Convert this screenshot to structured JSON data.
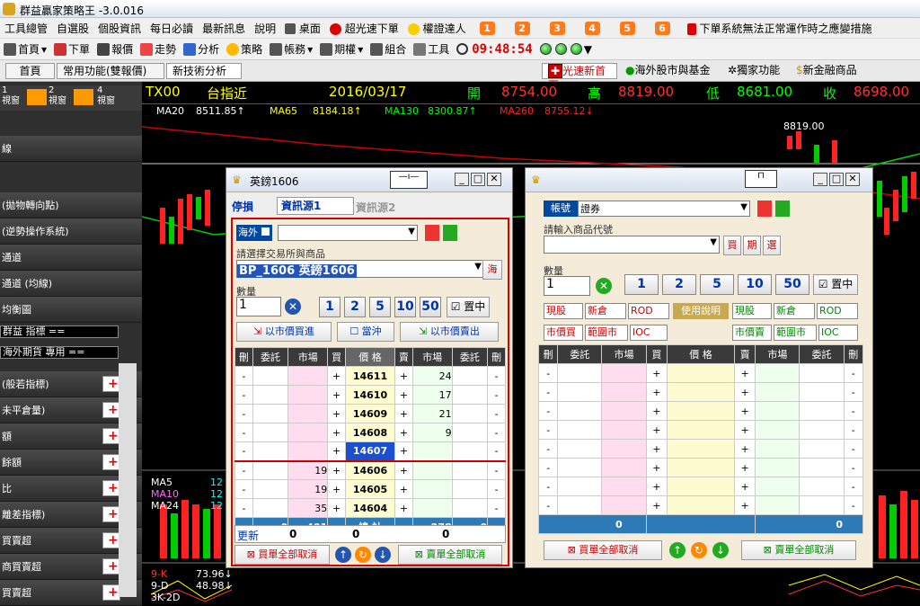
{
  "app": {
    "title": "群益贏家策略王 -3.0.016"
  },
  "menu": [
    "工具總管",
    "自選股",
    "個股資訊",
    "每日必讀",
    "最新訊息",
    "說明",
    "桌面",
    "超光速下單",
    "權證達人",
    "1",
    "2",
    "3",
    "4",
    "5",
    "6",
    "下單系統無法正常運作時之應變措施"
  ],
  "toolbar1": {
    "home": "首頁",
    "order": "下單",
    "quote": "報價",
    "trend": "走勢",
    "analysis": "分析",
    "strategy": "策略",
    "account": "帳務",
    "expiry": "期權",
    "combo": "組合",
    "tools": "工具",
    "clock": "09:48:54"
  },
  "toolbar2": {
    "tabs": [
      "首頁",
      "常用功能(雙報價)",
      "新技術分析"
    ],
    "fast_home": "光速新首頁",
    "overseas": "海外股市與基金",
    "exclusive": "獨家功能",
    "new_finance": "新金融商品"
  },
  "sidebar": {
    "view1": "1\n視窗",
    "view2": "2\n視窗",
    "view4": "4\n視窗",
    "rows": [
      "線",
      "(拋物轉向點)",
      "(逆勢操作系統)",
      "通道",
      "通道 (均線)",
      "均衡圖"
    ],
    "sel1": "群益 指標 ==",
    "sel2": "海外期貨 專用 ==",
    "rows2": [
      "(般若指標)",
      "未平倉量)",
      "額",
      "餘額",
      "比",
      "離差指標)",
      "買賣超",
      "商買賣超",
      "買賣超"
    ]
  },
  "chart": {
    "symbol": "TX00",
    "name": "台指近",
    "date": "2016/03/17",
    "open_label": "開",
    "open": "8754.00",
    "high_label": "高",
    "high": "8819.00",
    "low_label": "低",
    "low": "8681.00",
    "close_label": "收",
    "close": "8698.00",
    "ma": [
      {
        "label": "MA20",
        "value": "8511.85↑",
        "color": "#fff"
      },
      {
        "label": "MA65",
        "value": "8184.18↑",
        "color": "#ffff00"
      },
      {
        "label": "MA130",
        "value": "8300.87↑",
        "color": "#00ff00"
      },
      {
        "label": "MA260",
        "value": "8755.12↓",
        "color": "#ff2020"
      }
    ],
    "peak": "8819.00",
    "lower_ma": [
      {
        "label": "MA5",
        "value": "12",
        "color": "#fff"
      },
      {
        "label": "MA10",
        "value": "12",
        "color": "#ff66ff"
      },
      {
        "label": "MA24",
        "value": "12",
        "color": "#fff"
      }
    ],
    "kd": [
      {
        "label": "9-K",
        "value": "",
        "color": "#ff3030"
      },
      {
        "label": "9-D",
        "value": "73.96↓",
        "color": "#fff"
      },
      {
        "label": "3K-2D",
        "value": "48.98↓",
        "color": "#fff"
      }
    ]
  },
  "win1": {
    "title": "英鎊1606",
    "tab_stop": "停損",
    "tab_src1": "資訊源1",
    "tab_src2": "資訊源2",
    "market": "海外",
    "exchange_label": "請選擇交易所與商品",
    "product": "BP_1606 英鎊1606",
    "product_btn": "海",
    "qty_label": "數量",
    "qty": "1",
    "qty_btns": [
      "1",
      "2",
      "5",
      "10",
      "50"
    ],
    "chk_mid": "置中",
    "buy_mkt": "以市價買進",
    "day_trade": "當沖",
    "sell_mkt": "以市價賣出",
    "headers": [
      "刪",
      "委託",
      "市場",
      "買",
      "價 格",
      "賣",
      "市場",
      "委託",
      "刪"
    ],
    "rows": [
      [
        "-",
        "",
        "",
        "+",
        "14611",
        "+",
        "24",
        "",
        "-"
      ],
      [
        "-",
        "",
        "",
        "+",
        "14610",
        "+",
        "17",
        "",
        "-"
      ],
      [
        "-",
        "",
        "",
        "+",
        "14609",
        "+",
        "21",
        "",
        "-"
      ],
      [
        "-",
        "",
        "",
        "+",
        "14608",
        "+",
        "9",
        "",
        "-"
      ],
      [
        "-",
        "",
        "",
        "+",
        "14607",
        "+",
        "",
        "",
        "-"
      ],
      [
        "-",
        "",
        "19",
        "+",
        "14606",
        "+",
        "",
        "",
        "-"
      ],
      [
        "-",
        "",
        "19",
        "+",
        "14605",
        "+",
        "",
        "",
        "-"
      ],
      [
        "-",
        "",
        "35",
        "+",
        "14604",
        "+",
        "",
        "",
        "-"
      ]
    ],
    "total": {
      "left1": "0",
      "left2": "401",
      "label": "總 計",
      "right1": "278",
      "right2": "0"
    },
    "update": "更新",
    "f1": "0",
    "f2": "0",
    "f3": "0",
    "cancel_buy": "買單全部取消",
    "cancel_sell": "賣單全部取消"
  },
  "win2": {
    "account_label": "帳號",
    "account": "證券",
    "code_label": "請輸入商品代號",
    "buy": "買",
    "expiry": "期",
    "sell": "選",
    "qty_label": "數量",
    "qty": "1",
    "qty_btns": [
      "1",
      "2",
      "5",
      "10",
      "50"
    ],
    "chk_mid": "置中",
    "sel_a": [
      "現股",
      "新倉",
      "ROD"
    ],
    "help": "使用說明",
    "sel_b": [
      "現股",
      "新倉",
      "ROD"
    ],
    "mkt_buy": "市價買",
    "mkt_range_buy": "範圍市價",
    "ioc": "IOC",
    "mkt_sell": "市價賣",
    "mkt_range_sell": "範圍市價",
    "ioc2": "IOC",
    "headers": [
      "刪",
      "委託",
      "市場",
      "買",
      "價 格",
      "賣",
      "市場",
      "委託",
      "刪"
    ],
    "total_left": "0",
    "total_right": "0",
    "cancel_buy": "買單全部取消",
    "cancel_sell": "賣單全部取消"
  }
}
